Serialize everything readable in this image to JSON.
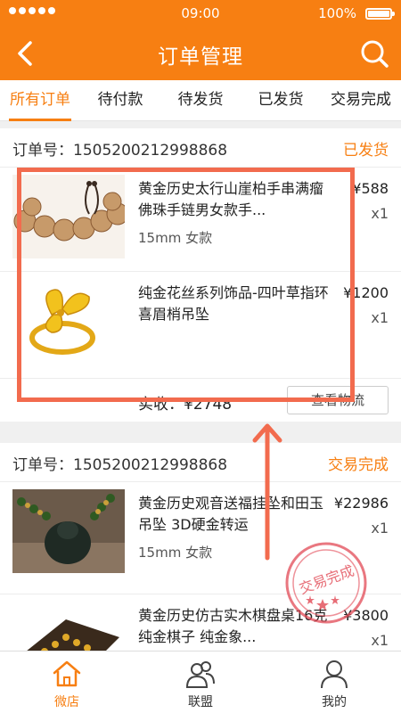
{
  "status_bar": {
    "time": "09:00",
    "battery": "100%"
  },
  "nav": {
    "title": "订单管理"
  },
  "tabs": [
    "所有订单",
    "待付款",
    "待发货",
    "已发货",
    "交易完成"
  ],
  "orders": [
    {
      "order_no": "订单号：1505200212998868",
      "status": "已发货",
      "items": [
        {
          "name": "黄金历史太行山崖柏手串满瘤佛珠手链男女款手...",
          "spec": "15mm 女款",
          "price": "¥588",
          "qty": "x1",
          "image": "wooden-bead-bracelet"
        },
        {
          "name": "纯金花丝系列饰品-四叶草指环喜眉梢吊坠",
          "spec": "",
          "price": "¥1200",
          "qty": "x1",
          "image": "gold-clover-ring"
        }
      ],
      "paid": "实收：¥2748",
      "action": "查看物流"
    },
    {
      "order_no": "订单号：1505200212998868",
      "status": "交易完成",
      "items": [
        {
          "name": "黄金历史观音送福挂坠和田玉吊坠 3D硬金转运",
          "spec": "15mm 女款",
          "price": "¥22986",
          "qty": "x1",
          "image": "jade-buddha-pendant"
        },
        {
          "name": "黄金历史仿古实木棋盘桌16克纯金棋子 纯金象...",
          "spec": "",
          "price": "¥3800",
          "qty": "x1",
          "image": "gold-chess-board"
        }
      ]
    }
  ],
  "stamp": {
    "text": "交易完成"
  },
  "tabbar": [
    {
      "label": "微店",
      "icon": "home-icon",
      "active": true
    },
    {
      "label": "联盟",
      "icon": "users-icon",
      "active": false
    },
    {
      "label": "我的",
      "icon": "person-icon",
      "active": false
    }
  ],
  "colors": {
    "brand": "#f77f12",
    "highlight": "#f26b4e",
    "stamp": "#e24a56"
  }
}
